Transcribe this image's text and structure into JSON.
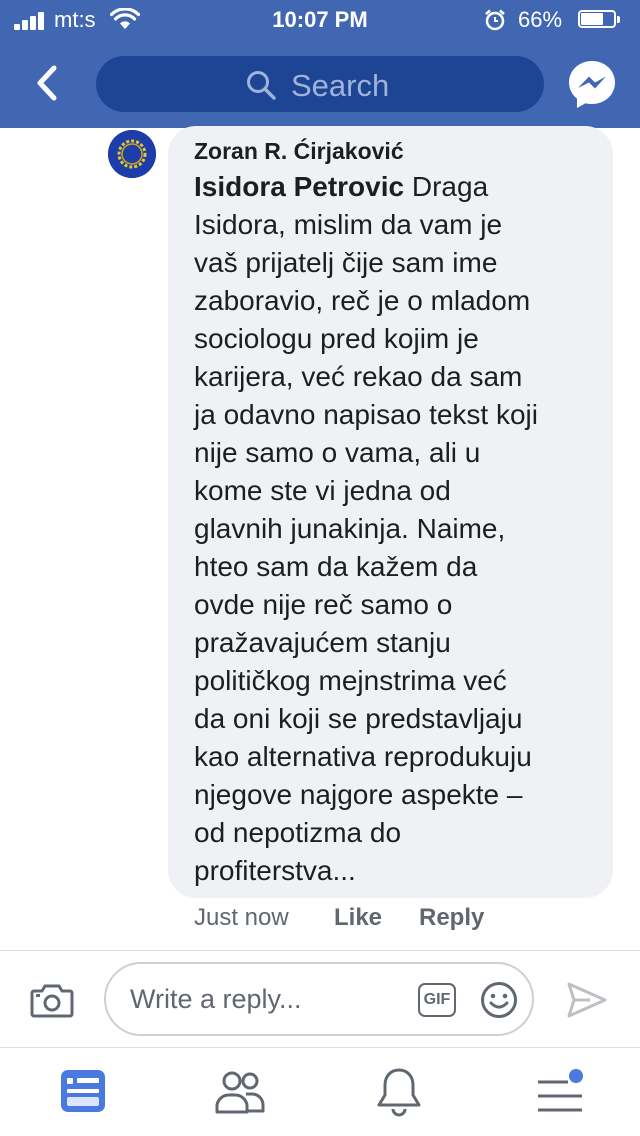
{
  "status_bar": {
    "carrier": "mt:s",
    "time": "10:07 PM",
    "battery_percent": "66%"
  },
  "nav": {
    "back_icon": "chevron-left-icon",
    "search_placeholder": "Search",
    "messenger_icon": "messenger-icon"
  },
  "comment": {
    "author": "Zoran R. Ćirjaković",
    "mention": "Isidora Petrovic",
    "lines": [
      " Draga",
      "Isidora, mislim da vam je",
      "vaš prijatelj čije sam ime",
      "zaboravio, reč je o mladom",
      "sociologu pred kojim je",
      "karijera, već rekao da sam",
      "ja odavno napisao tekst koji",
      "nije samo o vama, ali u",
      "kome ste vi jedna od",
      "glavnih junakinja. Naime,",
      "hteo sam da kažem da",
      "ovde nije reč samo o",
      "pražavajućem stanju",
      "političkog mejnstrima već",
      "da oni koji se predstavljaju",
      "kao alternativa reprodukuju",
      "njegove najgore aspekte –",
      "od nepotizma do",
      "profiterstva..."
    ],
    "timestamp": "Just now",
    "like_label": "Like",
    "reply_label": "Reply"
  },
  "composer": {
    "placeholder": "Write a reply...",
    "gif_label": "GIF"
  },
  "colors": {
    "brand": "#4267b2",
    "search_field": "#1e4594",
    "bubble": "#f0f1f4",
    "active_tab": "#4a79e0"
  },
  "tabs": [
    {
      "icon": "news-feed-icon",
      "active": true
    },
    {
      "icon": "friends-icon",
      "active": false
    },
    {
      "icon": "notifications-bell-icon",
      "active": false
    },
    {
      "icon": "menu-icon",
      "active": false,
      "has_badge": true
    }
  ]
}
